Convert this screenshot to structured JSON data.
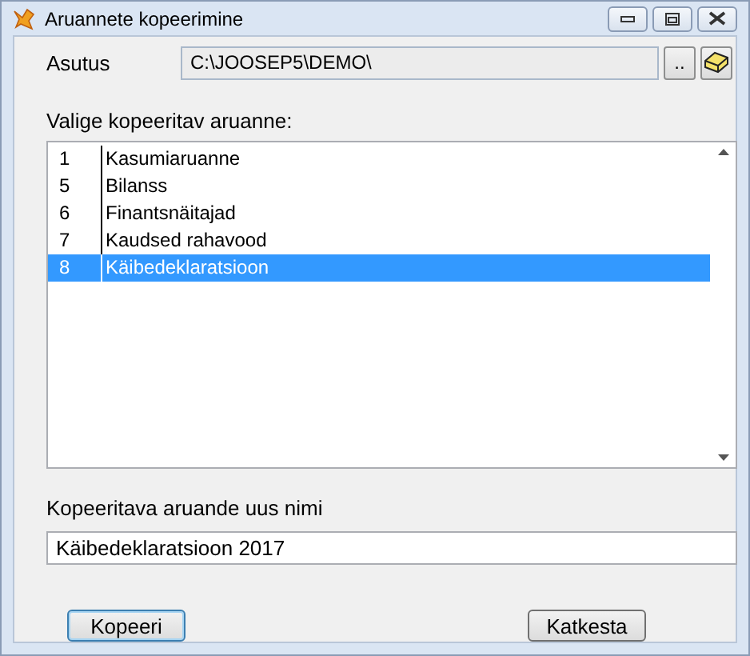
{
  "window": {
    "title": "Aruannete kopeerimine"
  },
  "organization": {
    "label": "Asutus",
    "value": "C:\\JOOSEP5\\DEMO\\",
    "browse_label": ".."
  },
  "report_list": {
    "label": "Valige kopeeritav aruanne:",
    "rows": [
      {
        "number": "1",
        "name": "Kasumiaruanne",
        "selected": false
      },
      {
        "number": "5",
        "name": "Bilanss",
        "selected": false
      },
      {
        "number": "6",
        "name": "Finantsnäitajad",
        "selected": false
      },
      {
        "number": "7",
        "name": "Kaudsed rahavood",
        "selected": false
      },
      {
        "number": "8",
        "name": "Käibedeklaratsioon",
        "selected": true
      }
    ]
  },
  "new_name": {
    "label": "Kopeeritava aruande uus nimi",
    "value": "Käibedeklaratsioon 2017"
  },
  "buttons": [
    {
      "label": "Kopeeri",
      "default": true
    },
    {
      "label": "Katkesta",
      "default": false
    }
  ]
}
